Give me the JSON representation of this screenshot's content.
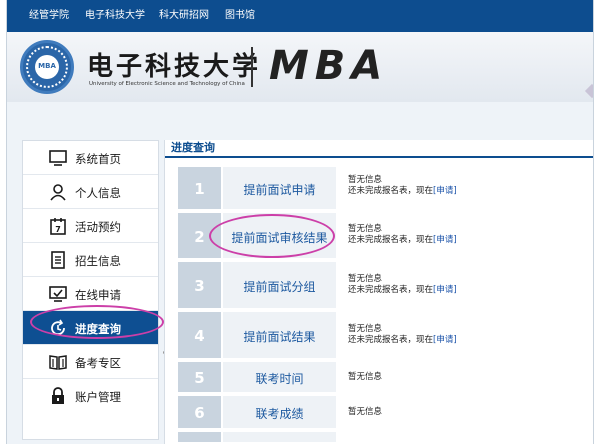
{
  "topnav": {
    "links": [
      "经管学院",
      "电子科技大学",
      "科大研招网",
      "图书馆"
    ]
  },
  "header": {
    "logo_text": "MBA",
    "cn_title": "电子科技大学",
    "en_title": "University of Electronic Science and Technology of China",
    "program": "MBA"
  },
  "sidebar": {
    "items": [
      {
        "label": "系统首页",
        "icon": "monitor-icon"
      },
      {
        "label": "个人信息",
        "icon": "user-icon"
      },
      {
        "label": "活动预约",
        "icon": "calendar-icon"
      },
      {
        "label": "招生信息",
        "icon": "document-icon"
      },
      {
        "label": "在线申请",
        "icon": "screen-check-icon"
      },
      {
        "label": "进度查询",
        "icon": "refresh-clock-icon"
      },
      {
        "label": "备考专区",
        "icon": "book-icon"
      },
      {
        "label": "账户管理",
        "icon": "lock-icon"
      }
    ],
    "active_index": 5
  },
  "panel": {
    "title": "进度查询",
    "rows": [
      {
        "num": "1",
        "stage": "提前面试申请",
        "status": "暂无信息",
        "note": "还未完成报名表，现在",
        "action": "[申请]"
      },
      {
        "num": "2",
        "stage": "提前面试审核结果",
        "status": "暂无信息",
        "note": "还未完成报名表，现在",
        "action": "[申请]"
      },
      {
        "num": "3",
        "stage": "提前面试分组",
        "status": "暂无信息",
        "note": "还未完成报名表，现在",
        "action": "[申请]"
      },
      {
        "num": "4",
        "stage": "提前面试结果",
        "status": "暂无信息",
        "note": "还未完成报名表，现在",
        "action": "[申请]"
      },
      {
        "num": "5",
        "stage": "联考时间",
        "status": "暂无信息",
        "note": "",
        "action": ""
      },
      {
        "num": "6",
        "stage": "联考成绩",
        "status": "暂无信息",
        "note": "",
        "action": ""
      }
    ]
  },
  "colors": {
    "nav_blue": "#0d4d8f",
    "active_blue": "#0e4f92",
    "highlight_oval": "#cc3fa8",
    "link_blue": "#1e5aa0"
  }
}
